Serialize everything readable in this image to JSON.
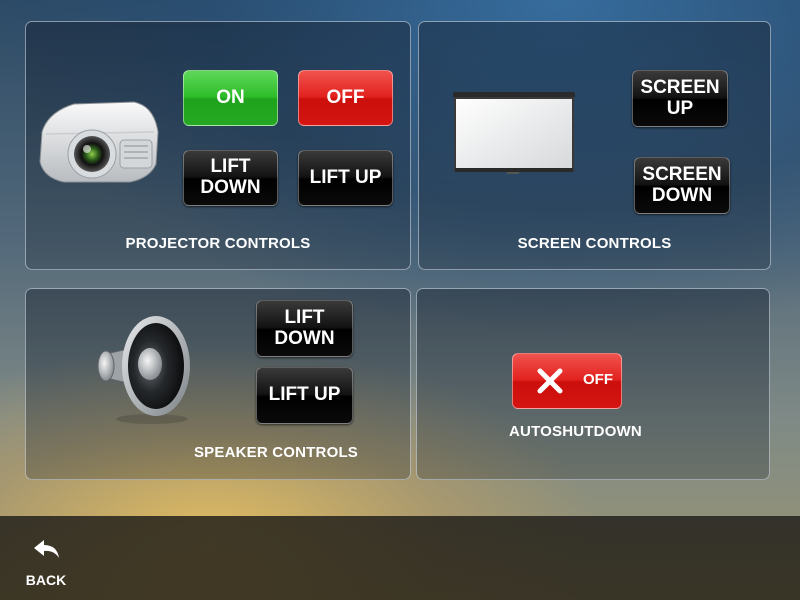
{
  "projector": {
    "title": "PROJECTOR CONTROLS",
    "on_label": "ON",
    "off_label": "OFF",
    "lift_down_label": "LIFT DOWN",
    "lift_up_label": "LIFT UP"
  },
  "screen": {
    "title": "SCREEN CONTROLS",
    "up_label": "SCREEN UP",
    "down_label": "SCREEN DOWN"
  },
  "speaker": {
    "title": "SPEAKER CONTROLS",
    "lift_down_label": "LIFT DOWN",
    "lift_up_label": "LIFT UP"
  },
  "autoshutdown": {
    "title": "AUTOSHUTDOWN",
    "toggle_label": "OFF",
    "state": "off"
  },
  "footer": {
    "back_label": "BACK"
  },
  "icons": {
    "projector": "projector-icon",
    "screen": "projection-screen-icon",
    "speaker": "speaker-icon",
    "close": "close-icon",
    "back": "back-arrow-icon"
  },
  "colors": {
    "on": "#2ebc2a",
    "off": "#e2211d",
    "button": "#000000"
  }
}
